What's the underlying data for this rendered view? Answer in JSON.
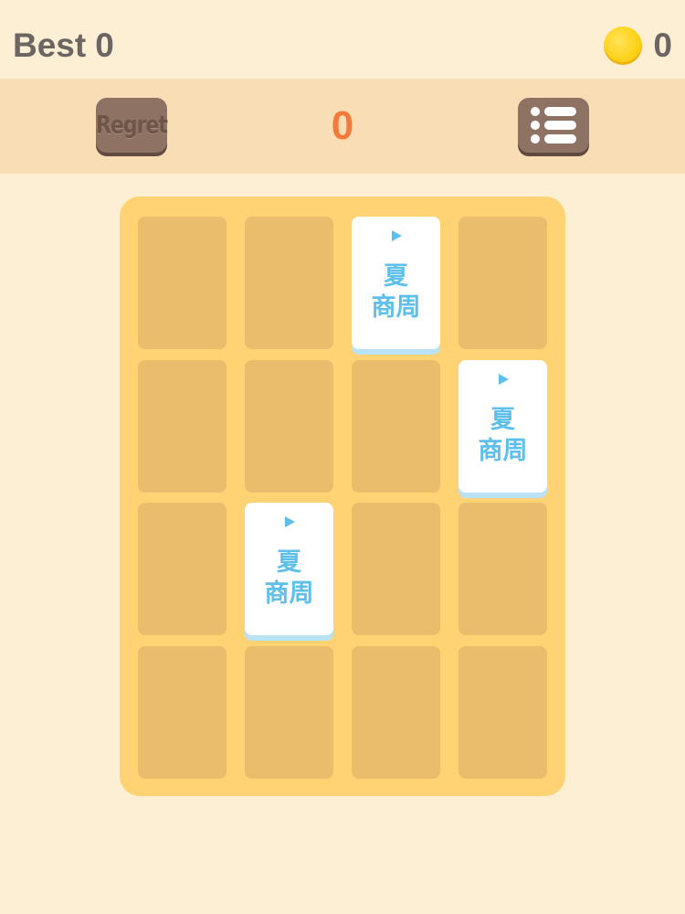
{
  "header": {
    "best_label": "Best",
    "best_value": "0",
    "coins": "0",
    "coin_icon": "gold-coin-icon"
  },
  "actions": {
    "regret_label": "Regret",
    "score": "0",
    "menu_icon": "menu-list-icon"
  },
  "board": {
    "rows": 4,
    "cols": 4,
    "tiles": [
      {
        "row": 0,
        "col": 2,
        "line1": "夏",
        "line2": "商周",
        "icon": "flag-icon"
      },
      {
        "row": 1,
        "col": 3,
        "line1": "夏",
        "line2": "商周",
        "icon": "flag-icon"
      },
      {
        "row": 2,
        "col": 1,
        "line1": "夏",
        "line2": "商周",
        "icon": "flag-icon"
      }
    ]
  },
  "colors": {
    "background": "#FDEFD3",
    "action_bar": "#F9DDB5",
    "board": "#FFD274",
    "empty_cell": "#E9BD6C",
    "tile": "#FFFFFF",
    "tile_text": "#5EC0EA",
    "score": "#F37A3A",
    "button": "#8E7365",
    "coin": "#FFD21A"
  }
}
